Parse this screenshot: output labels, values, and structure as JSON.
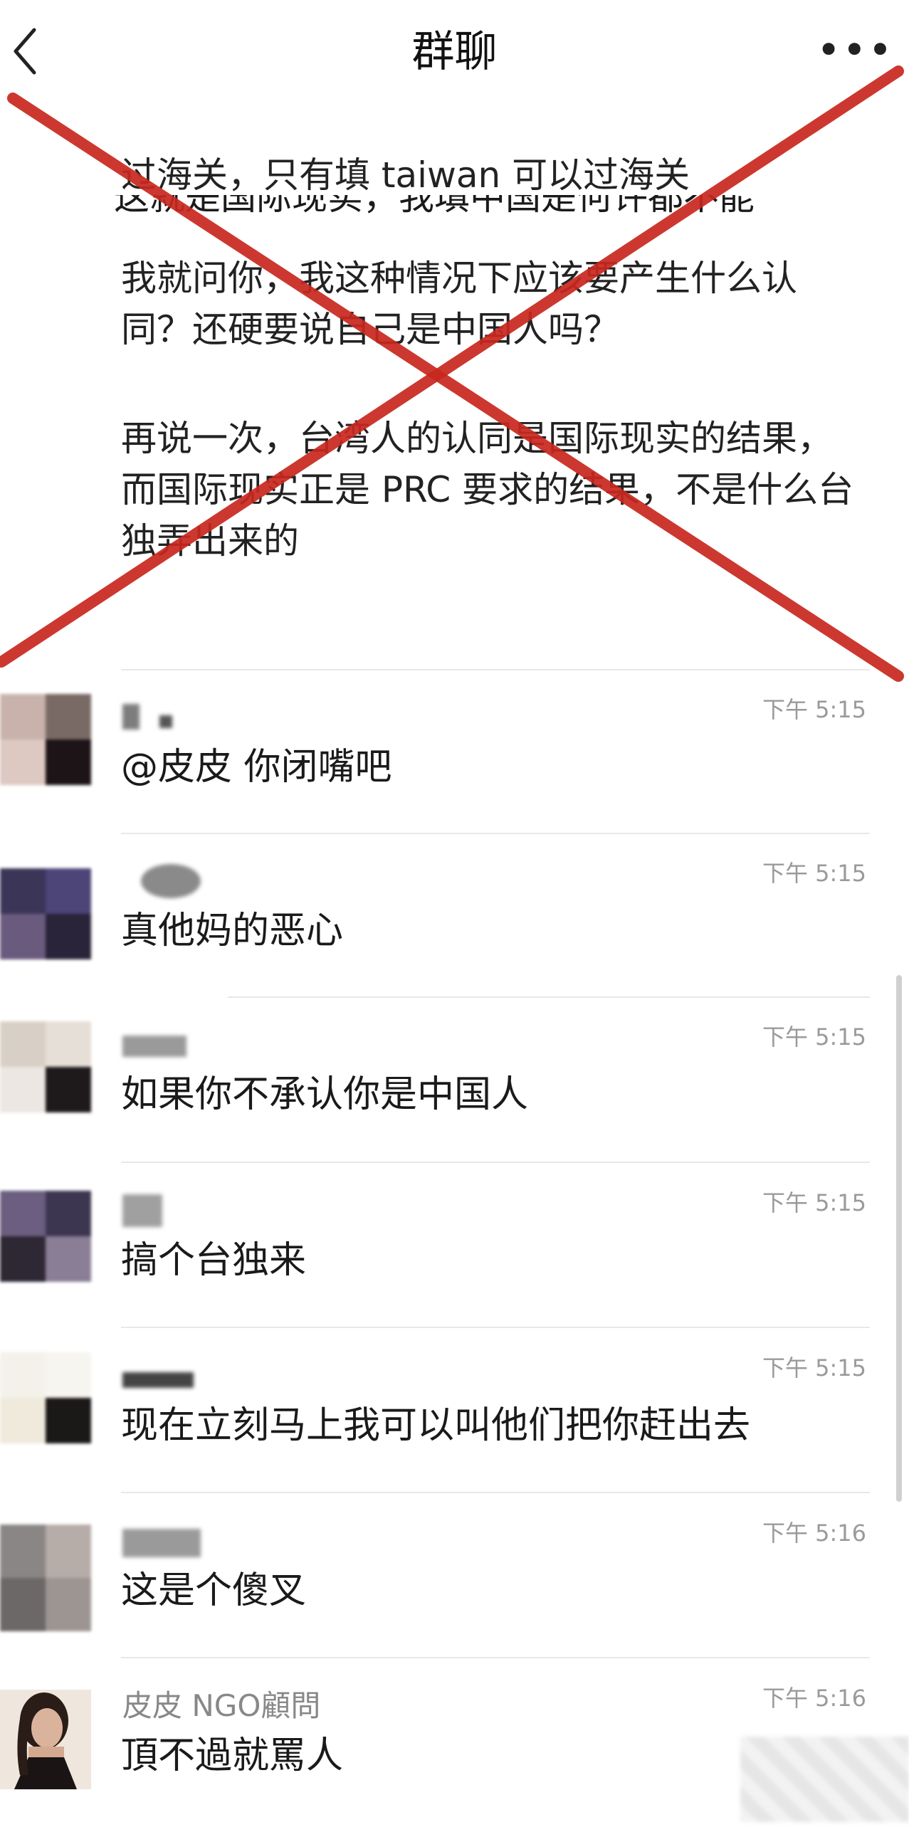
{
  "header": {
    "title": "群聊",
    "back_icon": "chevron-left-icon",
    "more_label": "•••"
  },
  "previous_message": {
    "cut_line": "这就是国际现实，我填中国是何许都不能",
    "paragraphs": [
      "过海关，只有填 taiwan 可以过海关",
      "我就问你，我这种情况下应该要产生什么认同？还硬要说自己是中国人吗？",
      "再说一次，台湾人的认同是国际现实的结果，\n而国际现实正是 PRC 要求的结果，不是什么台独弄出来的"
    ]
  },
  "messages": [
    {
      "sender": "",
      "time": "下午 5:15",
      "text": "@皮皮 你闭嘴吧"
    },
    {
      "sender": "",
      "time": "下午 5:15",
      "text": "真他妈的恶心"
    },
    {
      "sender": "",
      "time": "下午 5:15",
      "text": "如果你不承认你是中国人"
    },
    {
      "sender": "",
      "time": "下午 5:15",
      "text": "搞个台独来"
    },
    {
      "sender": "",
      "time": "下午 5:15",
      "text": "现在立刻马上我可以叫他们把你赶出去"
    },
    {
      "sender": "",
      "time": "下午 5:16",
      "text": "这是个傻叉"
    },
    {
      "sender": "皮皮 NGO顧問",
      "time": "下午 5:16",
      "text": "頂不過就罵人"
    }
  ],
  "colors": {
    "cross": "#c8281e",
    "timestamp": "#9a9a9a",
    "sender": "#888888"
  }
}
